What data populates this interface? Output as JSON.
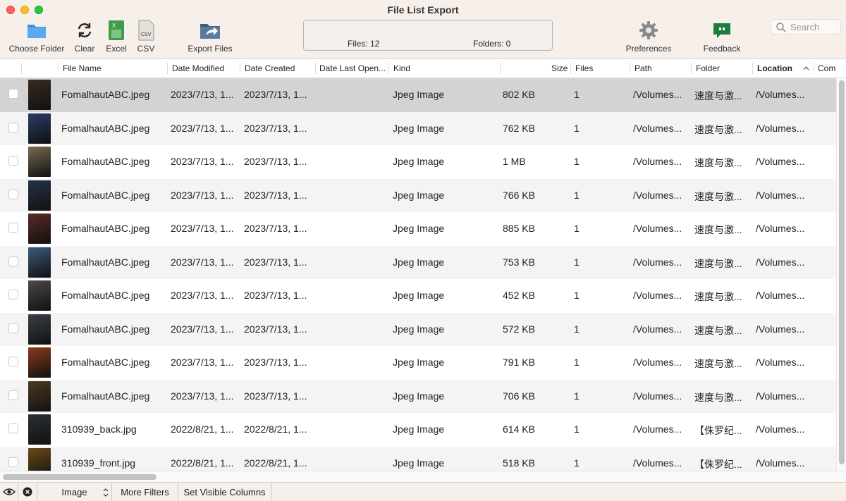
{
  "window": {
    "title": "File List Export"
  },
  "toolbar": {
    "choose_folder": "Choose Folder",
    "clear": "Clear",
    "excel": "Excel",
    "csv": "CSV",
    "export_files": "Export Files",
    "preferences": "Preferences",
    "feedback": "Feedback",
    "excel_icon_text": "X",
    "csv_icon_text": "CSV"
  },
  "status": {
    "files": "Files: 12",
    "folders": "Folders: 0"
  },
  "search": {
    "placeholder": "Search"
  },
  "columns": {
    "file_name": "File Name",
    "date_modified": "Date Modified",
    "date_created": "Date Created",
    "date_last_opened": "Date Last Open...",
    "kind": "Kind",
    "size": "Size",
    "files": "Files",
    "path": "Path",
    "folder": "Folder",
    "location": "Location",
    "comments": "Com"
  },
  "rows": [
    {
      "name": "FomalhautABC.jpeg",
      "modified": "2023/7/13, 1...",
      "created": "2023/7/13, 1...",
      "opened": "",
      "kind": "Jpeg Image",
      "size": "802 KB",
      "files": "1",
      "path": "/Volumes...",
      "folder": "速度与激...",
      "location": "/Volumes...",
      "thumb": "#3a2a22"
    },
    {
      "name": "FomalhautABC.jpeg",
      "modified": "2023/7/13, 1...",
      "created": "2023/7/13, 1...",
      "opened": "",
      "kind": "Jpeg Image",
      "size": "762 KB",
      "files": "1",
      "path": "/Volumes...",
      "folder": "速度与激...",
      "location": "/Volumes...",
      "thumb": "#2b3b6b"
    },
    {
      "name": "FomalhautABC.jpeg",
      "modified": "2023/7/13, 1...",
      "created": "2023/7/13, 1...",
      "opened": "",
      "kind": "Jpeg Image",
      "size": "1 MB",
      "files": "1",
      "path": "/Volumes...",
      "folder": "速度与激...",
      "location": "/Volumes...",
      "thumb": "#7a6a52"
    },
    {
      "name": "FomalhautABC.jpeg",
      "modified": "2023/7/13, 1...",
      "created": "2023/7/13, 1...",
      "opened": "",
      "kind": "Jpeg Image",
      "size": "766 KB",
      "files": "1",
      "path": "/Volumes...",
      "folder": "速度与激...",
      "location": "/Volumes...",
      "thumb": "#23324a"
    },
    {
      "name": "FomalhautABC.jpeg",
      "modified": "2023/7/13, 1...",
      "created": "2023/7/13, 1...",
      "opened": "",
      "kind": "Jpeg Image",
      "size": "885 KB",
      "files": "1",
      "path": "/Volumes...",
      "folder": "速度与激...",
      "location": "/Volumes...",
      "thumb": "#5a2a28"
    },
    {
      "name": "FomalhautABC.jpeg",
      "modified": "2023/7/13, 1...",
      "created": "2023/7/13, 1...",
      "opened": "",
      "kind": "Jpeg Image",
      "size": "753 KB",
      "files": "1",
      "path": "/Volumes...",
      "folder": "速度与激...",
      "location": "/Volumes...",
      "thumb": "#3c5a7a"
    },
    {
      "name": "FomalhautABC.jpeg",
      "modified": "2023/7/13, 1...",
      "created": "2023/7/13, 1...",
      "opened": "",
      "kind": "Jpeg Image",
      "size": "452 KB",
      "files": "1",
      "path": "/Volumes...",
      "folder": "速度与激...",
      "location": "/Volumes...",
      "thumb": "#4a4a4a"
    },
    {
      "name": "FomalhautABC.jpeg",
      "modified": "2023/7/13, 1...",
      "created": "2023/7/13, 1...",
      "opened": "",
      "kind": "Jpeg Image",
      "size": "572 KB",
      "files": "1",
      "path": "/Volumes...",
      "folder": "速度与激...",
      "location": "/Volumes...",
      "thumb": "#3a4048"
    },
    {
      "name": "FomalhautABC.jpeg",
      "modified": "2023/7/13, 1...",
      "created": "2023/7/13, 1...",
      "opened": "",
      "kind": "Jpeg Image",
      "size": "791 KB",
      "files": "1",
      "path": "/Volumes...",
      "folder": "速度与激...",
      "location": "/Volumes...",
      "thumb": "#8a3a1a"
    },
    {
      "name": "FomalhautABC.jpeg",
      "modified": "2023/7/13, 1...",
      "created": "2023/7/13, 1...",
      "opened": "",
      "kind": "Jpeg Image",
      "size": "706 KB",
      "files": "1",
      "path": "/Volumes...",
      "folder": "速度与激...",
      "location": "/Volumes...",
      "thumb": "#4a3a22"
    },
    {
      "name": "310939_back.jpg",
      "modified": "2022/8/21, 1...",
      "created": "2022/8/21, 1...",
      "opened": "",
      "kind": "Jpeg Image",
      "size": "614 KB",
      "files": "1",
      "path": "/Volumes...",
      "folder": "【侏罗纪...",
      "location": "/Volumes...",
      "thumb": "#2a3038"
    },
    {
      "name": "310939_front.jpg",
      "modified": "2022/8/21, 1...",
      "created": "2022/8/21, 1...",
      "opened": "",
      "kind": "Jpeg Image",
      "size": "518 KB",
      "files": "1",
      "path": "/Volumes...",
      "folder": "【侏罗纪...",
      "location": "/Volumes...",
      "thumb": "#6a4a1a"
    }
  ],
  "bottom": {
    "filter_type": "Image",
    "more_filters": "More Filters",
    "set_visible_columns": "Set Visible Columns"
  }
}
